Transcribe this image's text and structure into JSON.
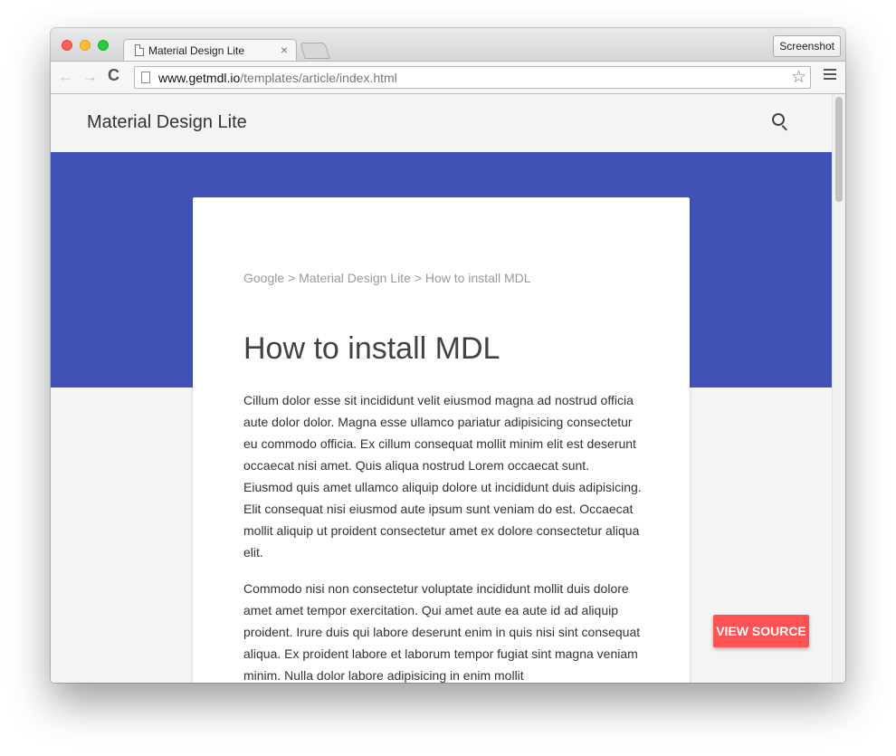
{
  "browser": {
    "tab_title": "Material Design Lite",
    "tab_close_glyph": "×",
    "screenshot_button": "Screenshot",
    "url_host": "www.getmdl.io",
    "url_path": "/templates/article/index.html",
    "back_glyph": "←",
    "forward_glyph": "→",
    "reload_glyph": "C",
    "star_glyph": "☆",
    "icons": [
      "close-dot",
      "minimize-dot",
      "maximize-dot",
      "document-icon",
      "star-icon",
      "menu-icon"
    ]
  },
  "app": {
    "title": "Material Design Lite",
    "search_icon": "search-icon"
  },
  "colors": {
    "hero": "#3f51b5",
    "fab": "#ff5252",
    "page_background": "#f4f4f4"
  },
  "article": {
    "breadcrumbs": [
      "Google",
      "Material Design Lite",
      "How to install MDL"
    ],
    "breadcrumb_sep": " > ",
    "title": "How to install MDL",
    "paragraphs": [
      "Cillum dolor esse sit incididunt velit eiusmod magna ad nostrud officia aute dolor dolor. Magna esse ullamco pariatur adipisicing consectetur eu commodo officia. Ex cillum consequat mollit minim elit est deserunt occaecat nisi amet. Quis aliqua nostrud Lorem occaecat sunt. Eiusmod quis amet ullamco aliquip dolore ut incididunt duis adipisicing. Elit consequat nisi eiusmod aute ipsum sunt veniam do est. Occaecat mollit aliquip ut proident consectetur amet ex dolore consectetur aliqua elit.",
      "Commodo nisi non consectetur voluptate incididunt mollit duis dolore amet amet tempor exercitation. Qui amet aute ea aute id ad aliquip proident. Irure duis qui labore deserunt enim in quis nisi sint consequat aliqua. Ex proident labore et laborum tempor fugiat sint magna veniam minim. Nulla dolor labore adipisicing in enim mollit"
    ]
  },
  "view_source_button": "VIEW SOURCE"
}
